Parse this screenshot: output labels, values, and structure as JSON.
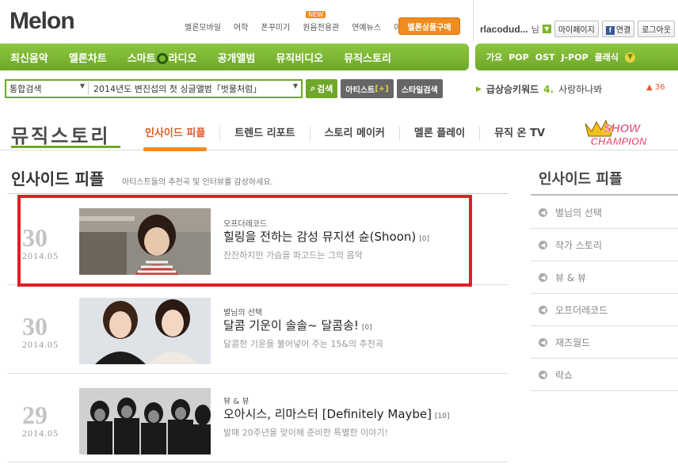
{
  "header": {
    "logo_text": "Melon",
    "util_links": [
      "멜론모바일",
      "어학",
      "폰꾸미기",
      "원음전용관",
      "연예뉴스",
      "이벤트"
    ],
    "new_badge": "NEW",
    "buy_button": "멜론상품구매",
    "username": "rlacodud...",
    "nim": "님",
    "mypage": "마이페이지",
    "connect": "연결",
    "logout": "로그아웃"
  },
  "nav": {
    "items": [
      "최신음악",
      "멜론차트",
      "스마트",
      "라디오",
      "공개앨범",
      "뮤직비디오",
      "뮤직스토리"
    ],
    "genres": [
      "가요",
      "POP",
      "OST",
      "J-POP",
      "클래식"
    ]
  },
  "search": {
    "category": "통합검색",
    "query": "2014년도 변진섭의 첫 싱글앨범「벗물처럼」",
    "search_button": "검색",
    "artist_button": "아티스트",
    "artist_plus": "[+]",
    "style_button": "스타일검색",
    "hot_label": "급상승키워드",
    "hot_rank": "4.",
    "hot_keyword": "사랑하나봐",
    "hot_count": "36"
  },
  "section": {
    "brand": "뮤직스토리",
    "tabs": [
      "인사이드 피플",
      "트렌드 리포트",
      "스토리 메이커",
      "멜론 플레이",
      "뮤직 온 TV"
    ],
    "active_tab": 0,
    "show_line1": "SHOW",
    "show_line2": "CHAMPION"
  },
  "main": {
    "title": "인사이드 피플",
    "subtitle": "아티스트들의 추천곡 및 인터뷰를 감상하세요.",
    "items": [
      {
        "day": "30",
        "date": "2014.05",
        "category": "오프더레코드",
        "title": "힐링을 전하는 감성 뮤지션 슌(Shoon)",
        "comments": "[0]",
        "desc": "잔잔하지만 가슴을 파고드는 그의 음악"
      },
      {
        "day": "30",
        "date": "2014.05",
        "category": "별님의 선택",
        "title": "달콤 기운이 솔솔~ 달콤송!",
        "comments": "[0]",
        "desc": "달콤한 기운을 불어넣어 주는 15&의 추천곡"
      },
      {
        "day": "29",
        "date": "2014.05",
        "category": "뷰 & 뷰",
        "title": "오아시스, 리마스터 [Definitely Maybe]",
        "comments": "[10]",
        "desc": "발매 20주년을 맞이해 준비한 특별한 이야기!"
      }
    ]
  },
  "sidebar": {
    "title": "인사이드 피플",
    "items": [
      "별님의 선택",
      "작가 스토리",
      "뷰 & 뷰",
      "오프더레코드",
      "재즈월드",
      "락쇼"
    ]
  },
  "colors": {
    "brand_green": "#7ab51d",
    "accent_orange": "#f08c1e",
    "highlight_red": "#e01e25"
  }
}
